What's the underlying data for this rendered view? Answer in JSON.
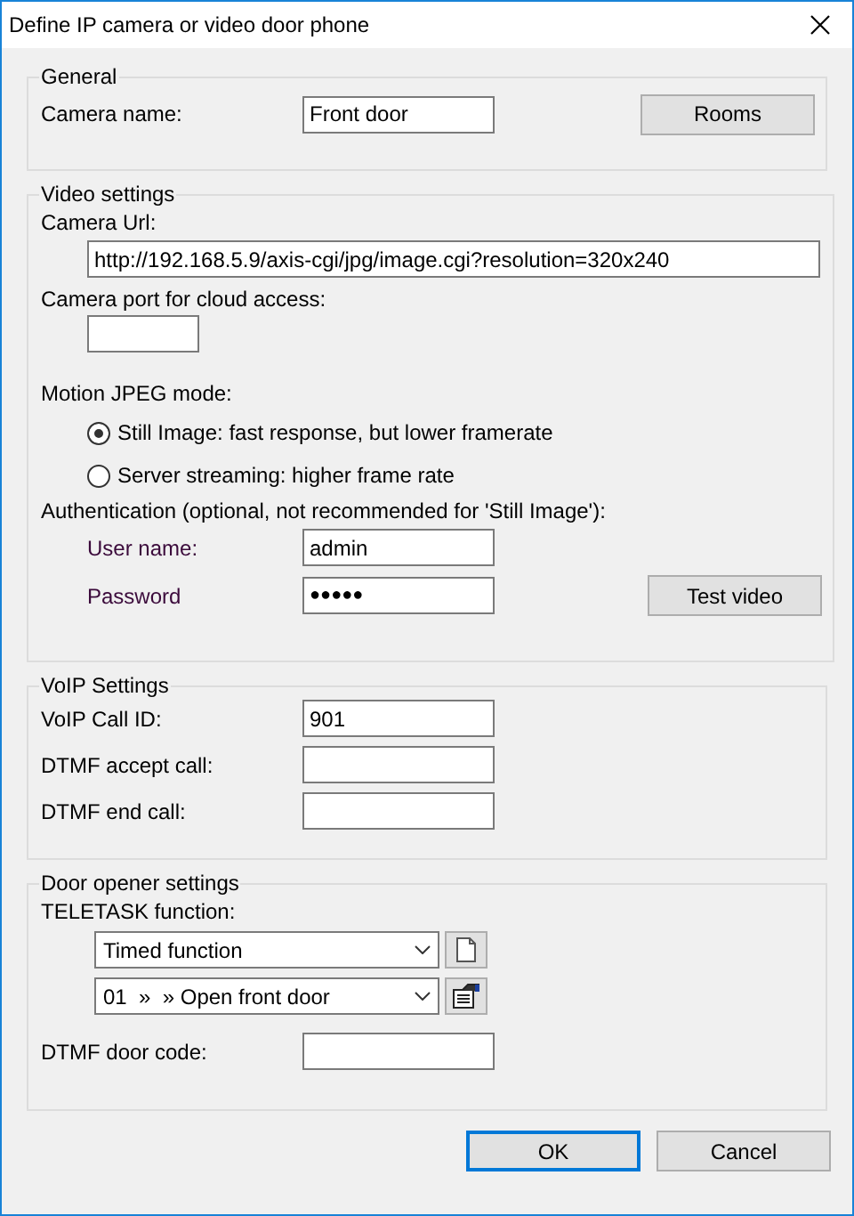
{
  "window": {
    "title": "Define IP camera or video door phone"
  },
  "general": {
    "legend": "General",
    "camera_name": {
      "label": "Camera name:",
      "value": "Front door"
    },
    "rooms_button": "Rooms"
  },
  "video": {
    "legend": "Video settings",
    "url": {
      "label": "Camera Url:",
      "value": "http://192.168.5.9/axis-cgi/jpg/image.cgi?resolution=320x240"
    },
    "port": {
      "label": "Camera port for cloud access:"
    },
    "mode_label": "Motion JPEG mode:",
    "modes": [
      {
        "label": "Still Image: fast response, but lower framerate",
        "selected": true
      },
      {
        "label": "Server streaming: higher frame rate",
        "selected": false
      }
    ],
    "auth_label": "Authentication (optional, not recommended for 'Still Image'):",
    "user": {
      "label": "User name:",
      "value": "admin"
    },
    "password": {
      "label": "Password",
      "value": "●●●●●"
    },
    "test_button": "Test video"
  },
  "voip": {
    "legend": "VoIP Settings",
    "fields": [
      {
        "label": "VoIP Call ID:",
        "value": "901"
      },
      {
        "label": "DTMF accept call:"
      },
      {
        "label": "DTMF end call:"
      }
    ]
  },
  "door": {
    "legend": "Door opener settings",
    "function_label": "TELETASK function:",
    "selects": [
      {
        "value": "Timed function",
        "kind": "new"
      },
      {
        "value": "01  »  » Open front door",
        "kind": "properties"
      }
    ],
    "code": {
      "label": "DTMF door code:"
    }
  },
  "buttons": [
    {
      "label": "OK",
      "default": true
    },
    {
      "label": "Cancel",
      "default": false
    }
  ]
}
